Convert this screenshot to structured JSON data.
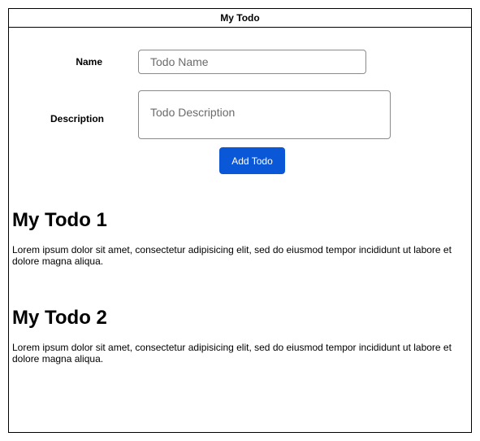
{
  "window": {
    "title": "My Todo"
  },
  "form": {
    "name_label": "Name",
    "name_placeholder": "Todo Name",
    "name_value": "",
    "description_label": "Description",
    "description_placeholder": "Todo Description",
    "description_value": "",
    "submit_label": "Add Todo"
  },
  "todos": [
    {
      "title": "My Todo 1",
      "description": "Lorem ipsum dolor sit amet, consectetur adipisicing elit, sed do eiusmod tempor incididunt ut labore et dolore magna aliqua."
    },
    {
      "title": "My Todo 2",
      "description": "Lorem ipsum dolor sit amet, consectetur adipisicing elit, sed do eiusmod tempor incididunt ut labore et dolore magna aliqua."
    }
  ],
  "colors": {
    "button_bg": "#0a57d8",
    "button_text": "#ffffff",
    "border": "#000000",
    "input_border": "#8a8a8a"
  }
}
